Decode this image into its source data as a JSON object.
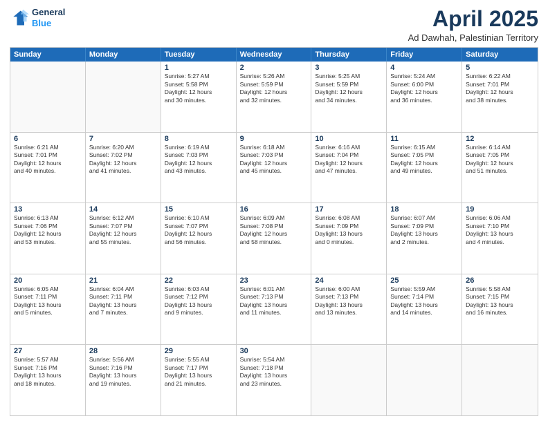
{
  "header": {
    "logo_line1": "General",
    "logo_line2": "Blue",
    "month": "April 2025",
    "location": "Ad Dawhah, Palestinian Territory"
  },
  "weekdays": [
    "Sunday",
    "Monday",
    "Tuesday",
    "Wednesday",
    "Thursday",
    "Friday",
    "Saturday"
  ],
  "rows": [
    [
      {
        "day": "",
        "text": ""
      },
      {
        "day": "",
        "text": ""
      },
      {
        "day": "1",
        "text": "Sunrise: 5:27 AM\nSunset: 5:58 PM\nDaylight: 12 hours\nand 30 minutes."
      },
      {
        "day": "2",
        "text": "Sunrise: 5:26 AM\nSunset: 5:59 PM\nDaylight: 12 hours\nand 32 minutes."
      },
      {
        "day": "3",
        "text": "Sunrise: 5:25 AM\nSunset: 5:59 PM\nDaylight: 12 hours\nand 34 minutes."
      },
      {
        "day": "4",
        "text": "Sunrise: 5:24 AM\nSunset: 6:00 PM\nDaylight: 12 hours\nand 36 minutes."
      },
      {
        "day": "5",
        "text": "Sunrise: 6:22 AM\nSunset: 7:01 PM\nDaylight: 12 hours\nand 38 minutes."
      }
    ],
    [
      {
        "day": "6",
        "text": "Sunrise: 6:21 AM\nSunset: 7:01 PM\nDaylight: 12 hours\nand 40 minutes."
      },
      {
        "day": "7",
        "text": "Sunrise: 6:20 AM\nSunset: 7:02 PM\nDaylight: 12 hours\nand 41 minutes."
      },
      {
        "day": "8",
        "text": "Sunrise: 6:19 AM\nSunset: 7:03 PM\nDaylight: 12 hours\nand 43 minutes."
      },
      {
        "day": "9",
        "text": "Sunrise: 6:18 AM\nSunset: 7:03 PM\nDaylight: 12 hours\nand 45 minutes."
      },
      {
        "day": "10",
        "text": "Sunrise: 6:16 AM\nSunset: 7:04 PM\nDaylight: 12 hours\nand 47 minutes."
      },
      {
        "day": "11",
        "text": "Sunrise: 6:15 AM\nSunset: 7:05 PM\nDaylight: 12 hours\nand 49 minutes."
      },
      {
        "day": "12",
        "text": "Sunrise: 6:14 AM\nSunset: 7:05 PM\nDaylight: 12 hours\nand 51 minutes."
      }
    ],
    [
      {
        "day": "13",
        "text": "Sunrise: 6:13 AM\nSunset: 7:06 PM\nDaylight: 12 hours\nand 53 minutes."
      },
      {
        "day": "14",
        "text": "Sunrise: 6:12 AM\nSunset: 7:07 PM\nDaylight: 12 hours\nand 55 minutes."
      },
      {
        "day": "15",
        "text": "Sunrise: 6:10 AM\nSunset: 7:07 PM\nDaylight: 12 hours\nand 56 minutes."
      },
      {
        "day": "16",
        "text": "Sunrise: 6:09 AM\nSunset: 7:08 PM\nDaylight: 12 hours\nand 58 minutes."
      },
      {
        "day": "17",
        "text": "Sunrise: 6:08 AM\nSunset: 7:09 PM\nDaylight: 13 hours\nand 0 minutes."
      },
      {
        "day": "18",
        "text": "Sunrise: 6:07 AM\nSunset: 7:09 PM\nDaylight: 13 hours\nand 2 minutes."
      },
      {
        "day": "19",
        "text": "Sunrise: 6:06 AM\nSunset: 7:10 PM\nDaylight: 13 hours\nand 4 minutes."
      }
    ],
    [
      {
        "day": "20",
        "text": "Sunrise: 6:05 AM\nSunset: 7:11 PM\nDaylight: 13 hours\nand 5 minutes."
      },
      {
        "day": "21",
        "text": "Sunrise: 6:04 AM\nSunset: 7:11 PM\nDaylight: 13 hours\nand 7 minutes."
      },
      {
        "day": "22",
        "text": "Sunrise: 6:03 AM\nSunset: 7:12 PM\nDaylight: 13 hours\nand 9 minutes."
      },
      {
        "day": "23",
        "text": "Sunrise: 6:01 AM\nSunset: 7:13 PM\nDaylight: 13 hours\nand 11 minutes."
      },
      {
        "day": "24",
        "text": "Sunrise: 6:00 AM\nSunset: 7:13 PM\nDaylight: 13 hours\nand 13 minutes."
      },
      {
        "day": "25",
        "text": "Sunrise: 5:59 AM\nSunset: 7:14 PM\nDaylight: 13 hours\nand 14 minutes."
      },
      {
        "day": "26",
        "text": "Sunrise: 5:58 AM\nSunset: 7:15 PM\nDaylight: 13 hours\nand 16 minutes."
      }
    ],
    [
      {
        "day": "27",
        "text": "Sunrise: 5:57 AM\nSunset: 7:16 PM\nDaylight: 13 hours\nand 18 minutes."
      },
      {
        "day": "28",
        "text": "Sunrise: 5:56 AM\nSunset: 7:16 PM\nDaylight: 13 hours\nand 19 minutes."
      },
      {
        "day": "29",
        "text": "Sunrise: 5:55 AM\nSunset: 7:17 PM\nDaylight: 13 hours\nand 21 minutes."
      },
      {
        "day": "30",
        "text": "Sunrise: 5:54 AM\nSunset: 7:18 PM\nDaylight: 13 hours\nand 23 minutes."
      },
      {
        "day": "",
        "text": ""
      },
      {
        "day": "",
        "text": ""
      },
      {
        "day": "",
        "text": ""
      }
    ]
  ]
}
